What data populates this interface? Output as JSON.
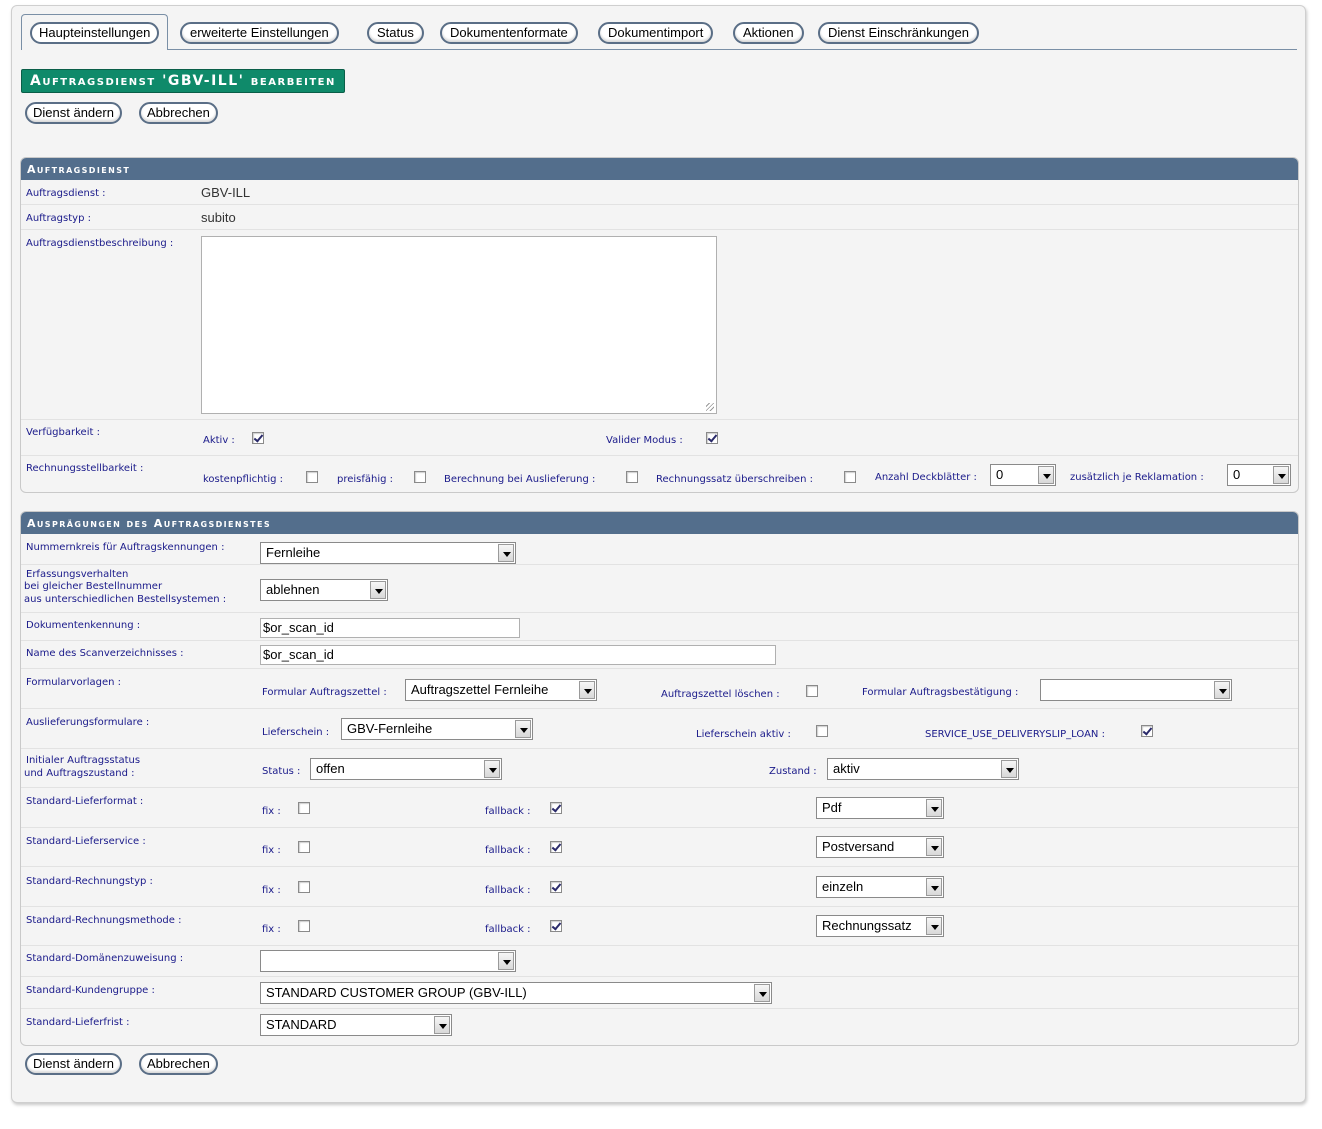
{
  "tabs": [
    "Haupteinstellungen",
    "erweiterte Einstellungen",
    "Status",
    "Dokumentenformate",
    "Dokumentimport",
    "Aktionen",
    "Dienst Einschränkungen"
  ],
  "title": "Auftragsdienst 'GBV-ILL' bearbeiten",
  "buttons": {
    "save": "Dienst ändern",
    "cancel": "Abbrechen"
  },
  "section1": {
    "header": "Auftragsdienst",
    "auftragsdienst_label": "Auftragsdienst :",
    "auftragsdienst_value": "GBV-ILL",
    "auftragstyp_label": "Auftragstyp :",
    "auftragstyp_value": "subito",
    "beschreibung_label": "Auftragsdienstbeschreibung :",
    "beschreibung_value": "",
    "verfuegbarkeit_label": "Verfügbarkeit :",
    "aktiv_label": "Aktiv :",
    "aktiv_checked": true,
    "valider_modus_label": "Valider Modus :",
    "valider_modus_checked": true,
    "rechnung_label": "Rechnungsstellbarkeit :",
    "kostenpflichtig_label": "kostenpflichtig :",
    "preisfaehig_label": "preisfähig :",
    "berechnung_label": "Berechnung bei Auslieferung :",
    "rechnungssatz_label": "Rechnungssatz überschreiben :",
    "deckblaetter_label": "Anzahl Deckblätter :",
    "deckblaetter_value": "0",
    "reklamation_label": "zusätzlich je Reklamation :",
    "reklamation_value": "0"
  },
  "section2": {
    "header": "Ausprägungen des Auftragsdienstes",
    "nummernkreis_label": "Nummernkreis für Auftragskennungen :",
    "nummernkreis_value": "Fernleihe",
    "erfassung_label_1": "Erfassungsverhalten",
    "erfassung_label_2": "bei gleicher Bestellnummer",
    "erfassung_label_3": "aus unterschiedlichen Bestellsystemen :",
    "erfassung_value": "ablehnen",
    "dokumentenkennung_label": "Dokumentenkennung :",
    "dokumentenkennung_value": "$or_scan_id",
    "scanverzeichnis_label": "Name des Scanverzeichnisses :",
    "scanverzeichnis_value": "$or_scan_id",
    "formularvorlagen_label": "Formularvorlagen :",
    "formular_auftragszettel_label": "Formular Auftragszettel :",
    "formular_auftragszettel_value": "Auftragszettel Fernleihe",
    "auftragszettel_loeschen_label": "Auftragszettel löschen :",
    "formular_bestaetigung_label": "Formular Auftragsbestätigung :",
    "formular_bestaetigung_value": "",
    "auslieferung_label": "Auslieferungsformulare :",
    "lieferschein_label": "Lieferschein :",
    "lieferschein_value": "GBV-Fernleihe",
    "lieferschein_aktiv_label": "Lieferschein aktiv :",
    "deliveryslip_label": "SERVICE_USE_DELIVERYSLIP_LOAN :",
    "initial_label_1": "Initialer Auftragsstatus",
    "initial_label_2": "und Auftragszustand :",
    "status_label": "Status :",
    "status_value": "offen",
    "zustand_label": "Zustand :",
    "zustand_value": "aktiv",
    "fix_label": "fix :",
    "fallback_label": "fallback :",
    "std_lieferformat_label": "Standard-Lieferformat :",
    "std_lieferformat_value": "Pdf",
    "std_lieferservice_label": "Standard-Lieferservice :",
    "std_lieferservice_value": "Postversand",
    "std_rechnungstyp_label": "Standard-Rechnungstyp :",
    "std_rechnungstyp_value": "einzeln",
    "std_rechnungsmethode_label": "Standard-Rechnungsmethode :",
    "std_rechnungsmethode_value": "Rechnungssatz",
    "std_domaene_label": "Standard-Domänenzuweisung :",
    "std_domaene_value": "",
    "std_kundengruppe_label": "Standard-Kundengruppe :",
    "std_kundengruppe_value": "STANDARD CUSTOMER GROUP (GBV-ILL)",
    "std_lieferfrist_label": "Standard-Lieferfrist :",
    "std_lieferfrist_value": "STANDARD"
  }
}
